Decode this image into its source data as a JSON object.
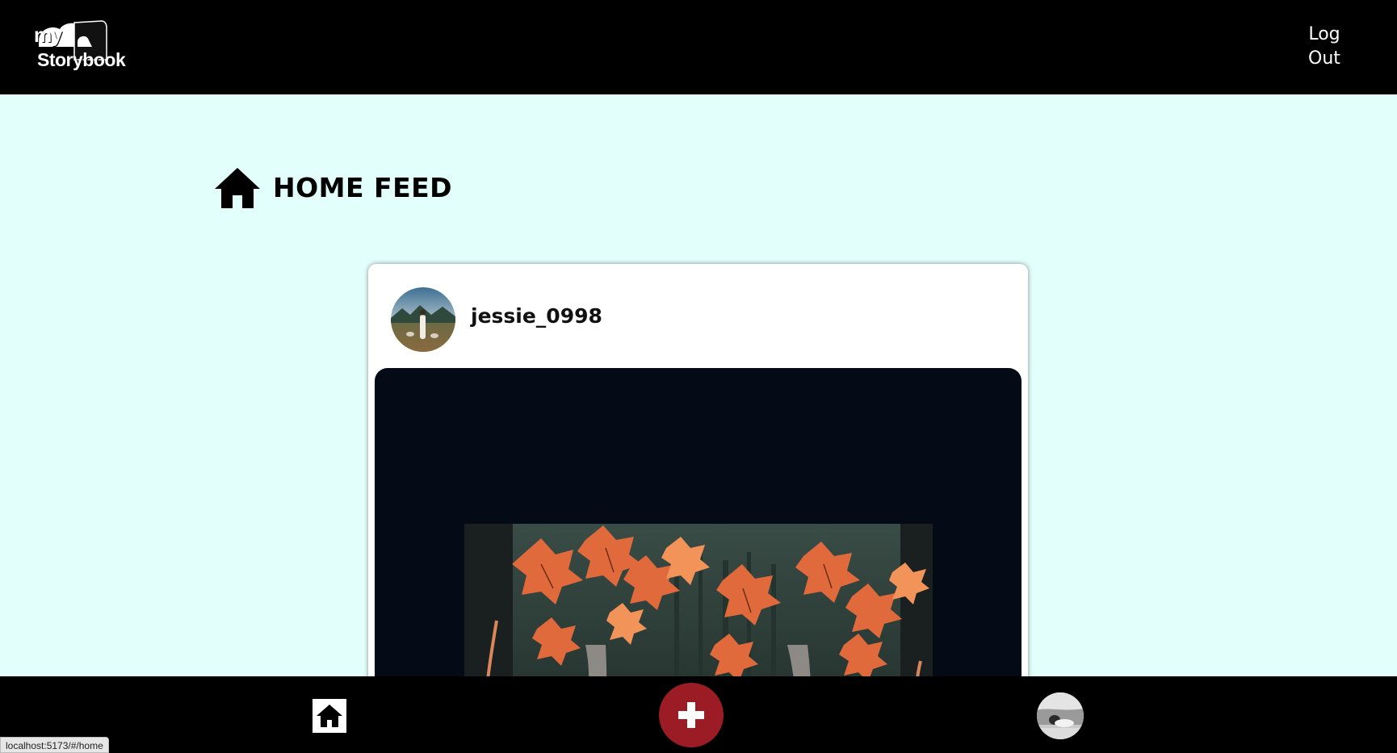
{
  "header": {
    "logo": {
      "line1": "my",
      "line2": "Storybook"
    },
    "logout_label": "Log Out"
  },
  "page": {
    "title": "HOME FEED",
    "title_icon": "home-icon"
  },
  "feed": {
    "posts": [
      {
        "username": "jessie_0998",
        "avatar_icon": "user-avatar",
        "image_icon": "autumn-forest-papercraft-image"
      }
    ]
  },
  "bottom_nav": {
    "home_icon": "home-icon",
    "add_icon": "plus-icon",
    "profile_icon": "profile-avatar"
  },
  "status_bar": {
    "url": "localhost:5173/#/home"
  },
  "colors": {
    "header_bg": "#000000",
    "page_bg": "#e3fffb",
    "add_button": "#9b1c24",
    "media_bg": "#040b16"
  }
}
